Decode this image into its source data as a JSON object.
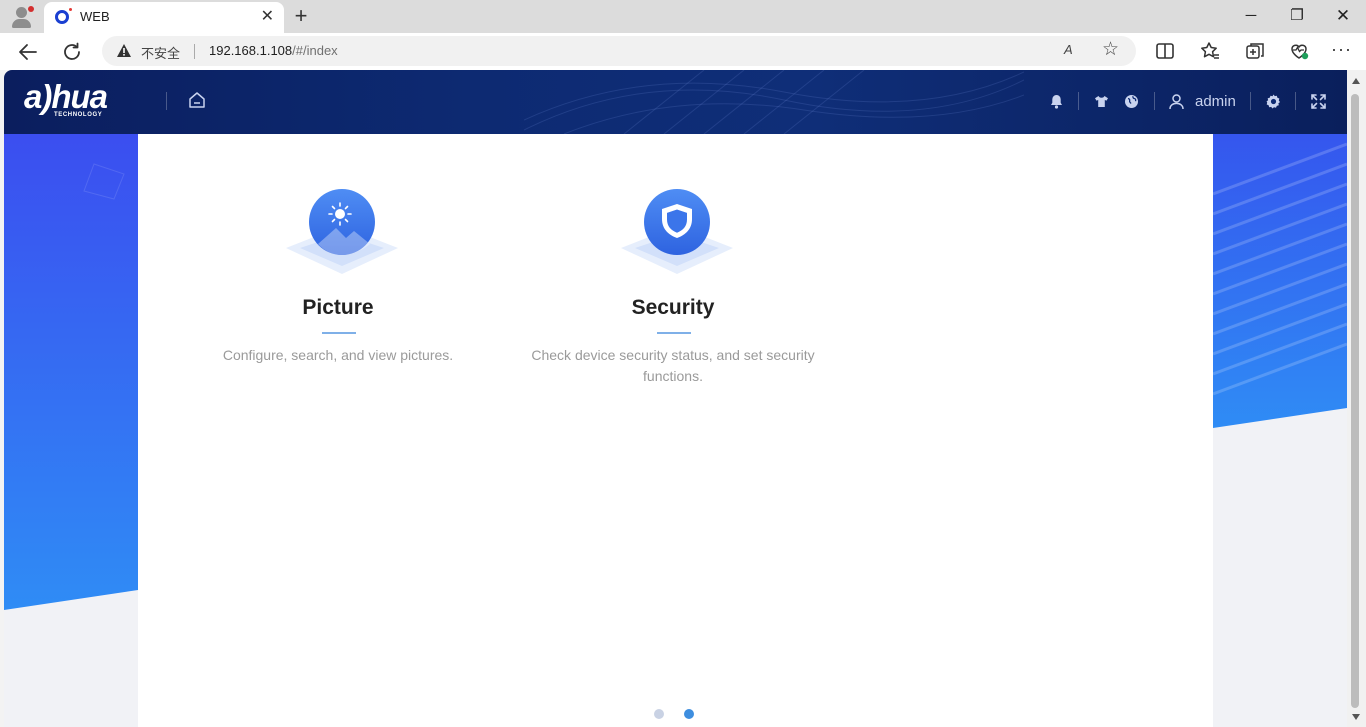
{
  "browser": {
    "tab_title": "WEB",
    "tab_close": "✕",
    "new_tab": "+",
    "window_controls": {
      "minimize": "─",
      "maximize": "❐",
      "close": "✕"
    },
    "address": {
      "security_label": "不安全",
      "url_host": "192.168.1.108",
      "url_path": "/#/index"
    },
    "toolbar": {
      "read_aloud": "A",
      "favorite_star": "☆",
      "more": "···"
    },
    "icons": [
      "profile-icon",
      "back-icon",
      "reload-icon",
      "warning-icon",
      "read-aloud-icon",
      "star-icon",
      "split-screen-icon",
      "favorites-icon",
      "collections-icon",
      "performance-icon",
      "more-icon"
    ]
  },
  "app": {
    "brand": {
      "logo_text": "a)hua",
      "logo_subtext": "TECHNOLOGY"
    },
    "header": {
      "username": "admin",
      "icons": [
        "home-icon",
        "bell-icon",
        "shirt-icon",
        "globe-icon",
        "user-icon",
        "gear-icon",
        "fullscreen-icon"
      ]
    },
    "cards": [
      {
        "title": "Picture",
        "description": "Configure, search, and view pictures.",
        "icon": "picture-icon"
      },
      {
        "title": "Security",
        "description": "Check device security status, and set security functions.",
        "icon": "shield-icon"
      }
    ],
    "pagination": {
      "total_pages": 2,
      "active_page": 2
    }
  },
  "colors": {
    "header_bg": "#0d2a72",
    "accent_blue": "#3e8edf",
    "side_band_top": "#3b4ef0",
    "side_band_bottom": "#2f8cf5",
    "card_text_muted": "#9a9a9a"
  }
}
